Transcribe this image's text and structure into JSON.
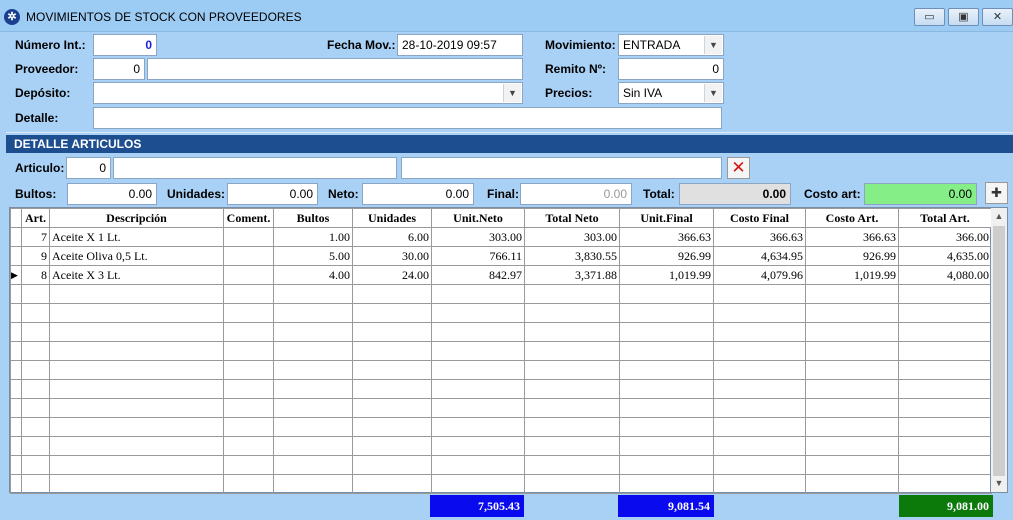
{
  "window": {
    "title": "MOVIMIENTOS DE  STOCK CON PROVEEDORES",
    "minimize": "▭",
    "restore": "▣",
    "close": "✕"
  },
  "header": {
    "numero_label": "Número Int.:",
    "numero_value": "0",
    "fecha_label": "Fecha Mov.:",
    "fecha_value": "28-10-2019 09:57",
    "movimiento_label": "Movimiento:",
    "movimiento_value": "ENTRADA",
    "proveedor_label": "Proveedor:",
    "proveedor_code": "0",
    "proveedor_name": "",
    "remito_label": "Remito Nº:",
    "remito_value": "0",
    "deposito_label": "Depósito:",
    "deposito_value": "",
    "precios_label": "Precios:",
    "precios_value": "Sin IVA",
    "detalle_label": "Detalle:",
    "detalle_value": ""
  },
  "section": {
    "title": "DETALLE ARTICULOS"
  },
  "detail": {
    "articulo_label": "Articulo:",
    "articulo_code": "0",
    "articulo_desc": "",
    "articulo_extra": "",
    "bultos_label": "Bultos:",
    "bultos_value": "0.00",
    "unidades_label": "Unidades:",
    "unidades_value": "0.00",
    "neto_label": "Neto:",
    "neto_value": "0.00",
    "final_label": "Final:",
    "final_value": "0.00",
    "total_label": "Total:",
    "total_value": "0.00",
    "costo_label": "Costo art:",
    "costo_value": "0.00"
  },
  "icons": {
    "app": "app-logo-icon",
    "delete": "delete-x-icon",
    "add": "plus-icon"
  },
  "colors": {
    "accent_bar": "#1c4e90",
    "total_blue": "#0a0aee",
    "total_green": "#0b7a0b",
    "costo_field": "#86ee86"
  },
  "table": {
    "columns": [
      "Art.",
      "Descripción",
      "Coment.",
      "Bultos",
      "Unidades",
      "Unit.Neto",
      "Total Neto",
      "Unit.Final",
      "Costo Final",
      "Costo Art.",
      "Total Art."
    ],
    "rows": [
      {
        "marker": "",
        "art": "7",
        "desc": "Aceite X 1 Lt.",
        "coment": "",
        "bultos": "1.00",
        "unidades": "6.00",
        "unit_neto": "303.00",
        "total_neto": "303.00",
        "unit_final": "366.63",
        "costo_final": "366.63",
        "costo_art": "366.63",
        "total_art": "366.00"
      },
      {
        "marker": "",
        "art": "9",
        "desc": "Aceite Oliva 0,5 Lt.",
        "coment": "",
        "bultos": "5.00",
        "unidades": "30.00",
        "unit_neto": "766.11",
        "total_neto": "3,830.55",
        "unit_final": "926.99",
        "costo_final": "4,634.95",
        "costo_art": "926.99",
        "total_art": "4,635.00"
      },
      {
        "marker": "▶",
        "art": "8",
        "desc": "Aceite X 3 Lt.",
        "coment": "",
        "bultos": "4.00",
        "unidades": "24.00",
        "unit_neto": "842.97",
        "total_neto": "3,371.88",
        "unit_final": "1,019.99",
        "costo_final": "4,079.96",
        "costo_art": "1,019.99",
        "total_art": "4,080.00"
      }
    ]
  },
  "totals": {
    "total_neto": "7,505.43",
    "total_final": "9,081.54",
    "total_art": "9,081.00"
  }
}
